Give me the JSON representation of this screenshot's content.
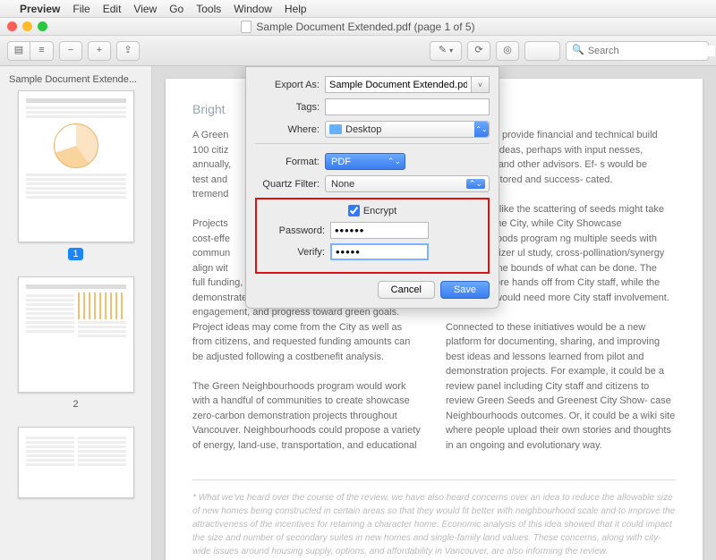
{
  "menubar": {
    "app": "Preview",
    "items": [
      "File",
      "Edit",
      "View",
      "Go",
      "Tools",
      "Window",
      "Help"
    ]
  },
  "window": {
    "title": "Sample Document Extended.pdf (page 1 of 5)"
  },
  "toolbar": {
    "search_placeholder": "Search"
  },
  "sidebar": {
    "title": "Sample Document Extende...",
    "pages": [
      "1",
      "2"
    ]
  },
  "document": {
    "heading": "Bright",
    "col1_p1": "A Green",
    "col1_p2": "100 citiz",
    "col1_p3": "annually,",
    "col1_p4": "test and",
    "col1_p5": "tremend",
    "col1_p6": "Projects",
    "col1_p7": "cost-effe",
    "col1_p8": "commun",
    "col1_p9": "align wit",
    "col1_p10": "full funding, project leaders would need to demonstrate behavioural changes, citizen engagement, and progress toward green goals. Project ideas may come from the City as well as from citizens, and requested funding amounts can be adjusted following a costbenefit analysis.",
    "col1_p11": "The Green Neighbourhoods program would work with a handful of communities to create showcase zero-carbon demonstration projects throughout Vancouver. Neighbourhoods could propose a variety of energy, land-use, transportation, and educational",
    "col2_p1": "a City would provide financial and technical build upon these ideas, perhaps with input nesses, academics, and other advisors. Ef- s would be closely monitored and success- cated.",
    "col2_p2": "eds Fund is like the scattering of seeds might take root within the City, while City Showcase Neighbourhoods program ng multiple seeds with serious fertilizer ul study, cross-pollination/synergy nd to push the bounds of what can be done. The former is more hands off from City staff, while the latter likely would need more City staff involvement.",
    "col2_p3": "Connected to these initiatives would be a new platform for documenting, sharing, and improving best ideas and lessons learned from pilot and demonstration projects. For example, it could be a review panel including City staff and citizens to review Green Seeds and Greenest City Show- case Neighbourhoods outcomes. Or, it could be a wiki site where people upload their own stories and thoughts in an ongoing and evolutionary way.",
    "footnote": "* What we've heard over the course of the review, we have also heard concerns over an idea to reduce the allowable size of new homes being constructed in certain areas so that they would fit better with neighbourhood scale and to improve the attractiveness of the incentives for retaining a character home. Economic analysis of this idea showed that it could impact the size and number of secondary suites in new homes and single-family land values. These concerns, along with city-wide issues around housing supply, options, and affordability in Vancouver, are also informing the review."
  },
  "dialog": {
    "export_as_label": "Export As:",
    "export_as_value": "Sample Document Extended.pdf",
    "tags_label": "Tags:",
    "tags_value": "",
    "where_label": "Where:",
    "where_value": "Desktop",
    "format_label": "Format:",
    "format_value": "PDF",
    "quartz_label": "Quartz Filter:",
    "quartz_value": "None",
    "encrypt_label": "Encrypt",
    "password_label": "Password:",
    "password_value": "••••••",
    "verify_label": "Verify:",
    "verify_value": "•••••",
    "cancel": "Cancel",
    "save": "Save"
  }
}
